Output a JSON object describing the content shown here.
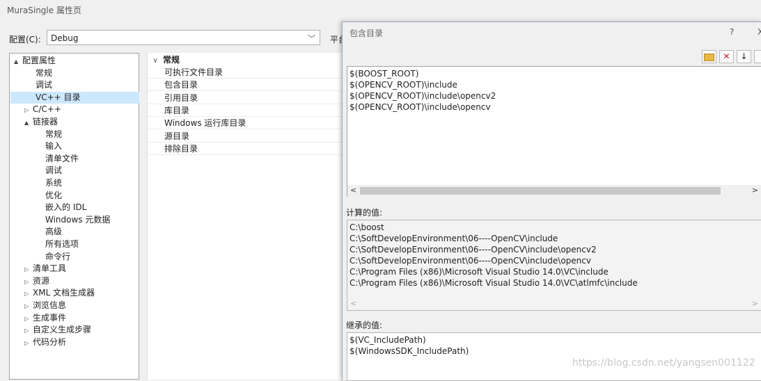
{
  "window": {
    "title": "MuraSingle 属性页"
  },
  "config": {
    "label": "配置(C):",
    "value": "Debug",
    "platform_label": "平台"
  },
  "tree": [
    {
      "label": "配置属性",
      "indent": 0,
      "expander": "▲",
      "selected": false
    },
    {
      "label": "常规",
      "indent": 1,
      "expander": "",
      "selected": false
    },
    {
      "label": "调试",
      "indent": 1,
      "expander": "",
      "selected": false
    },
    {
      "label": "VC++ 目录",
      "indent": 1,
      "expander": "",
      "selected": true
    },
    {
      "label": "C/C++",
      "indent": 1,
      "expander": "▷",
      "selected": false
    },
    {
      "label": "链接器",
      "indent": 1,
      "expander": "▲",
      "selected": false
    },
    {
      "label": "常规",
      "indent": 2,
      "expander": "",
      "selected": false
    },
    {
      "label": "输入",
      "indent": 2,
      "expander": "",
      "selected": false
    },
    {
      "label": "清单文件",
      "indent": 2,
      "expander": "",
      "selected": false
    },
    {
      "label": "调试",
      "indent": 2,
      "expander": "",
      "selected": false
    },
    {
      "label": "系统",
      "indent": 2,
      "expander": "",
      "selected": false
    },
    {
      "label": "优化",
      "indent": 2,
      "expander": "",
      "selected": false
    },
    {
      "label": "嵌入的 IDL",
      "indent": 2,
      "expander": "",
      "selected": false
    },
    {
      "label": "Windows 元数据",
      "indent": 2,
      "expander": "",
      "selected": false
    },
    {
      "label": "高级",
      "indent": 2,
      "expander": "",
      "selected": false
    },
    {
      "label": "所有选项",
      "indent": 2,
      "expander": "",
      "selected": false
    },
    {
      "label": "命令行",
      "indent": 2,
      "expander": "",
      "selected": false
    },
    {
      "label": "清单工具",
      "indent": 1,
      "expander": "▷",
      "selected": false
    },
    {
      "label": "资源",
      "indent": 1,
      "expander": "▷",
      "selected": false
    },
    {
      "label": "XML 文档生成器",
      "indent": 1,
      "expander": "▷",
      "selected": false
    },
    {
      "label": "浏览信息",
      "indent": 1,
      "expander": "▷",
      "selected": false
    },
    {
      "label": "生成事件",
      "indent": 1,
      "expander": "▷",
      "selected": false
    },
    {
      "label": "自定义生成步骤",
      "indent": 1,
      "expander": "▷",
      "selected": false
    },
    {
      "label": "代码分析",
      "indent": 1,
      "expander": "▷",
      "selected": false
    }
  ],
  "grid": {
    "category": "常规",
    "rows": [
      "可执行文件目录",
      "包含目录",
      "引用目录",
      "库目录",
      "Windows 运行库目录",
      "源目录",
      "排除目录"
    ]
  },
  "dialog": {
    "title": "包含目录",
    "help": "?",
    "close": "X",
    "entries": [
      "$(BOOST_ROOT)",
      "$(OPENCV_ROOT)\\include",
      "$(OPENCV_ROOT)\\include\\opencv2",
      "$(OPENCV_ROOT)\\include\\opencv"
    ],
    "computed_label": "计算的值:",
    "computed": [
      "C:\\boost",
      "C:\\SoftDevelopEnvironment\\06----OpenCV\\include",
      "C:\\SoftDevelopEnvironment\\06----OpenCV\\include\\opencv2",
      "C:\\SoftDevelopEnvironment\\06----OpenCV\\include\\opencv",
      "C:\\Program Files (x86)\\Microsoft Visual Studio 14.0\\VC\\include",
      "C:\\Program Files (x86)\\Microsoft Visual Studio 14.0\\VC\\atlmfc\\include"
    ],
    "inherited_label": "继承的值:",
    "inherited": [
      "$(VC_IncludePath)",
      "$(WindowsSDK_IncludePath)"
    ]
  },
  "watermark": "https://blog.csdn.net/yangsen001122"
}
